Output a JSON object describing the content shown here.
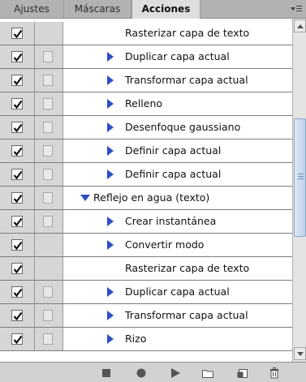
{
  "tabs": [
    {
      "label": "Ajustes",
      "active": false
    },
    {
      "label": "Máscaras",
      "active": false
    },
    {
      "label": "Acciones",
      "active": true
    }
  ],
  "panel_menu_icon": "panel-menu-icon",
  "rows": [
    {
      "label": "Rasterizar capa de texto",
      "checked": true,
      "dialog": false,
      "expander": "none",
      "level": 2
    },
    {
      "label": "Duplicar capa actual",
      "checked": true,
      "dialog": true,
      "expander": "collapsed",
      "level": 2
    },
    {
      "label": "Transformar capa actual",
      "checked": true,
      "dialog": true,
      "expander": "collapsed",
      "level": 2
    },
    {
      "label": "Relleno",
      "checked": true,
      "dialog": true,
      "expander": "collapsed",
      "level": 2
    },
    {
      "label": "Desenfoque gaussiano",
      "checked": true,
      "dialog": true,
      "expander": "collapsed",
      "level": 2
    },
    {
      "label": "Definir capa actual",
      "checked": true,
      "dialog": true,
      "expander": "collapsed",
      "level": 2
    },
    {
      "label": "Definir capa actual",
      "checked": true,
      "dialog": true,
      "expander": "collapsed",
      "level": 2
    },
    {
      "label": "Reflejo en agua (texto)",
      "checked": true,
      "dialog": true,
      "expander": "expanded",
      "level": 1
    },
    {
      "label": "Crear instantánea",
      "checked": true,
      "dialog": true,
      "expander": "collapsed",
      "level": 2
    },
    {
      "label": "Convertir modo",
      "checked": true,
      "dialog": false,
      "expander": "collapsed",
      "level": 2
    },
    {
      "label": "Rasterizar capa de texto",
      "checked": true,
      "dialog": false,
      "expander": "none",
      "level": 2
    },
    {
      "label": "Duplicar capa actual",
      "checked": true,
      "dialog": true,
      "expander": "collapsed",
      "level": 2
    },
    {
      "label": "Transformar capa actual",
      "checked": true,
      "dialog": true,
      "expander": "collapsed",
      "level": 2
    },
    {
      "label": "Rizo",
      "checked": true,
      "dialog": true,
      "expander": "collapsed",
      "level": 2
    }
  ],
  "toolbar": [
    {
      "name": "stop-playing-button",
      "icon": "stop-icon"
    },
    {
      "name": "record-button",
      "icon": "record-icon"
    },
    {
      "name": "play-selection-button",
      "icon": "play-icon"
    },
    {
      "name": "new-set-button",
      "icon": "folder-icon"
    },
    {
      "name": "new-action-button",
      "icon": "new-item-icon"
    },
    {
      "name": "delete-button",
      "icon": "trash-icon"
    }
  ],
  "colors": {
    "expander": "#2e4fc7",
    "panel_bg": "#d6d6d6",
    "list_bg": "#ffffff",
    "scroll_thumb": "#bcd0ea"
  }
}
